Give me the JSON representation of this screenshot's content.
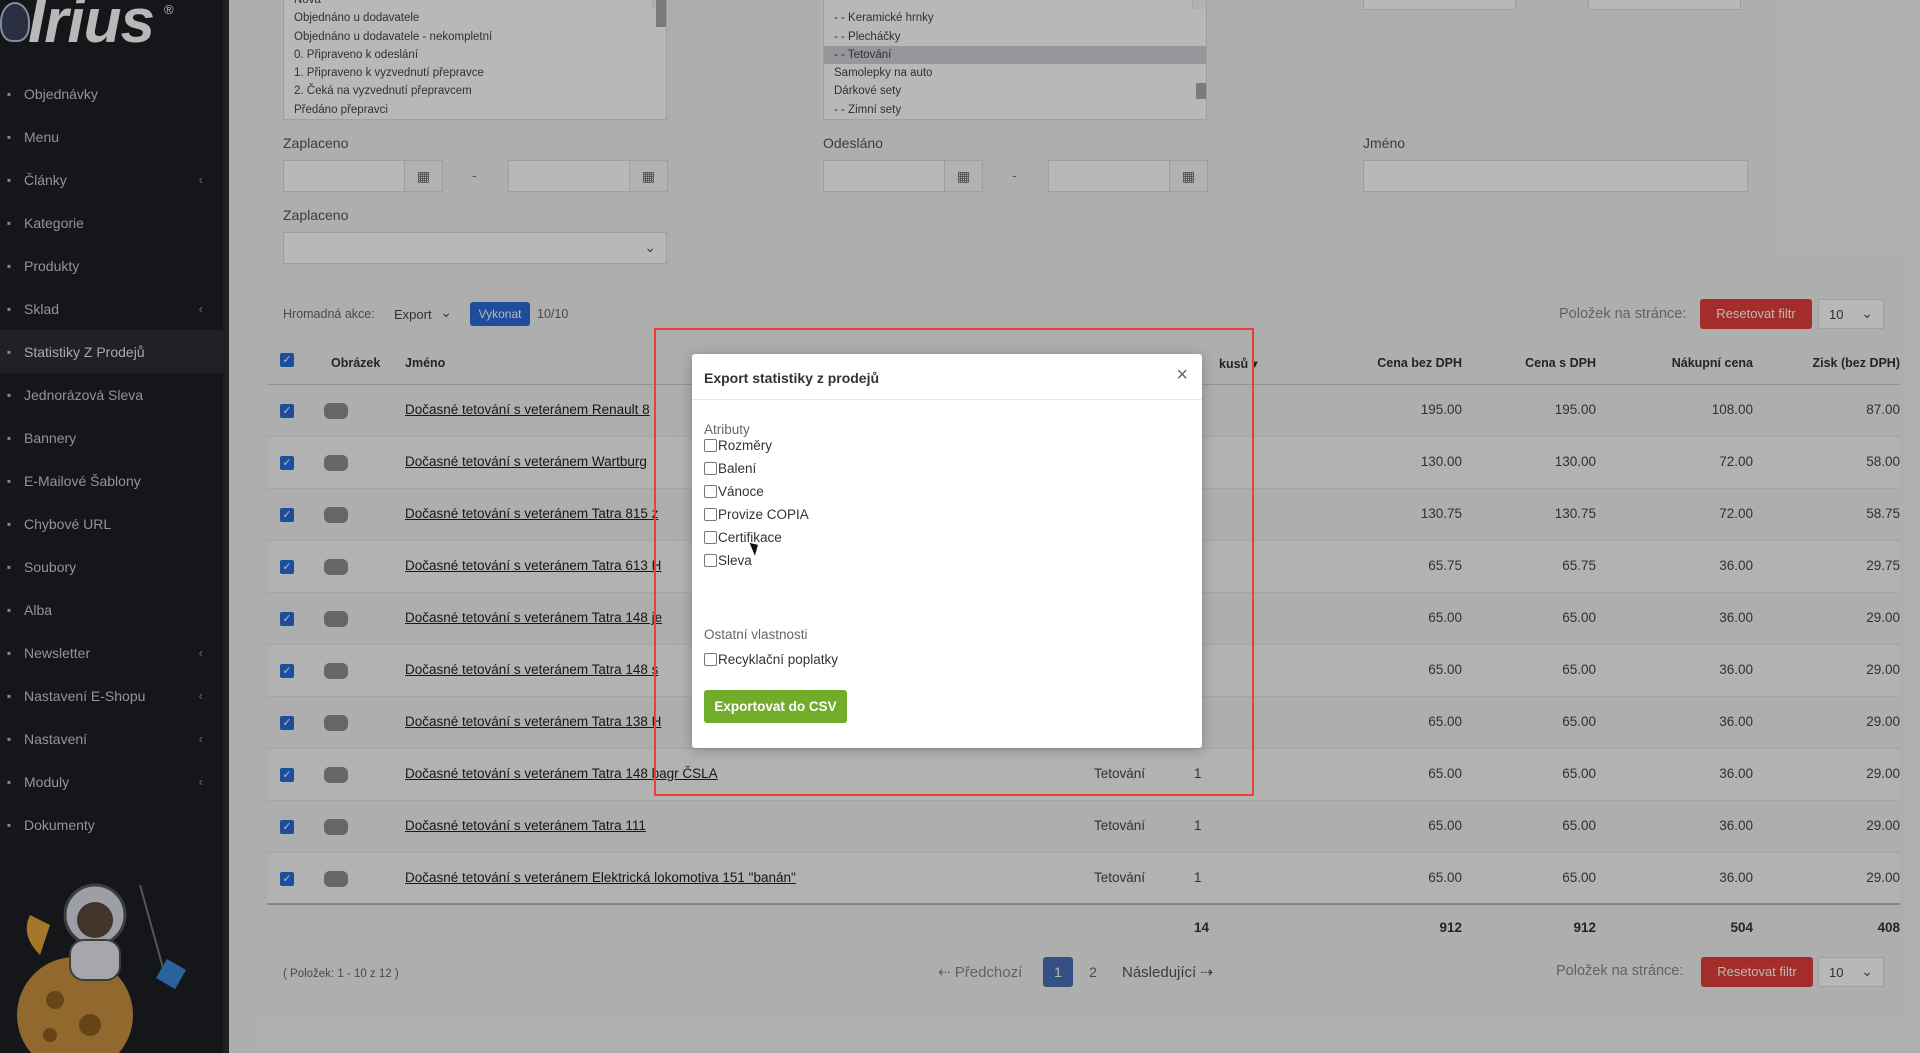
{
  "brand": {
    "logo_text": "Irius",
    "reg": "®"
  },
  "sidebar": {
    "items": [
      {
        "label": "Objednávky",
        "icon": "cart-icon",
        "chevron": false,
        "active": false
      },
      {
        "label": "Menu",
        "icon": "menu-icon",
        "chevron": false,
        "active": false
      },
      {
        "label": "Články",
        "icon": "pencil-icon",
        "chevron": true,
        "active": false
      },
      {
        "label": "Kategorie",
        "icon": "list-icon",
        "chevron": false,
        "active": false
      },
      {
        "label": "Produkty",
        "icon": "ball-icon",
        "chevron": false,
        "active": false
      },
      {
        "label": "Sklad",
        "icon": "warehouse-icon",
        "chevron": true,
        "active": false
      },
      {
        "label": "Statistiky Z Prodejů",
        "icon": "chart-icon",
        "chevron": false,
        "active": true
      },
      {
        "label": "Jednorázová Sleva",
        "icon": "tag-icon",
        "chevron": false,
        "active": false
      },
      {
        "label": "Bannery",
        "icon": "image-icon",
        "chevron": false,
        "active": false
      },
      {
        "label": "E-Mailové Šablony",
        "icon": "mail-icon",
        "chevron": false,
        "active": false
      },
      {
        "label": "Chybové URL",
        "icon": "link-icon",
        "chevron": false,
        "active": false
      },
      {
        "label": "Soubory",
        "icon": "file-icon",
        "chevron": false,
        "active": false
      },
      {
        "label": "Alba",
        "icon": "camera-icon",
        "chevron": false,
        "active": false
      },
      {
        "label": "Newsletter",
        "icon": "newsletter-icon",
        "chevron": true,
        "active": false
      },
      {
        "label": "Nastavení E-Shopu",
        "icon": "gear-icon",
        "chevron": true,
        "active": false
      },
      {
        "label": "Nastavení",
        "icon": "cog-icon",
        "chevron": true,
        "active": false
      },
      {
        "label": "Moduly",
        "icon": "puzzle-icon",
        "chevron": true,
        "active": false
      },
      {
        "label": "Dokumenty",
        "icon": "docs-icon",
        "chevron": false,
        "active": false
      }
    ]
  },
  "filters": {
    "status_list": [
      "Nová",
      "Objednáno u dodavatele",
      "Objednáno u dodavatele - nekompletní",
      "0. Připraveno k odeslání",
      "1. Připraveno k vyzvednutí přepravce",
      "2. Čeká na vyzvednutí přepravcem",
      "Předáno přepravci"
    ],
    "category_list": [
      "- - Keramické hrnky",
      "- - Plecháčky",
      "- - Tetování",
      "Samolepky na auto",
      "Dárkové sety",
      "- - Zimní sety"
    ],
    "category_selected_index": 2,
    "paid_label": "Zaplaceno",
    "sent_label": "Odesláno",
    "name_label": "Jméno",
    "paid_select_label": "Zaplaceno",
    "range_dash": "-"
  },
  "toolbar": {
    "bulk_label": "Hromadná akce:",
    "bulk_value": "Export",
    "execute": "Vykonat",
    "count": "10/10",
    "per_page_label": "Položek na stránce:",
    "reset": "Resetovat filtr",
    "per_page_value": "10"
  },
  "table": {
    "headers": {
      "image": "Obrázek",
      "name": "Jméno",
      "pieces": "kusů",
      "price_ex": "Cena bez DPH",
      "price_inc": "Cena s DPH",
      "purchase": "Nákupní cena",
      "profit": "Zisk (bez DPH)"
    },
    "rows": [
      {
        "name": "Dočasné tetování s veteránem Renault 8",
        "category": "",
        "qty": "",
        "price_ex": "195.00",
        "price_inc": "195.00",
        "purchase": "108.00",
        "profit": "87.00"
      },
      {
        "name": "Dočasné tetování s veteránem Wartburg",
        "category": "",
        "qty": "",
        "price_ex": "130.00",
        "price_inc": "130.00",
        "purchase": "72.00",
        "profit": "58.00"
      },
      {
        "name": "Dočasné tetování s veteránem Tatra 815 z",
        "category": "",
        "qty": "",
        "price_ex": "130.75",
        "price_inc": "130.75",
        "purchase": "72.00",
        "profit": "58.75"
      },
      {
        "name": "Dočasné tetování s veteránem Tatra 613 H",
        "category": "",
        "qty": "",
        "price_ex": "65.75",
        "price_inc": "65.75",
        "purchase": "36.00",
        "profit": "29.75"
      },
      {
        "name": "Dočasné tetování s veteránem Tatra 148 je",
        "category": "",
        "qty": "",
        "price_ex": "65.00",
        "price_inc": "65.00",
        "purchase": "36.00",
        "profit": "29.00"
      },
      {
        "name": "Dočasné tetování s veteránem Tatra 148 s",
        "category": "",
        "qty": "",
        "price_ex": "65.00",
        "price_inc": "65.00",
        "purchase": "36.00",
        "profit": "29.00"
      },
      {
        "name": "Dočasné tetování s veteránem Tatra 138 H",
        "category": "",
        "qty": "",
        "price_ex": "65.00",
        "price_inc": "65.00",
        "purchase": "36.00",
        "profit": "29.00"
      },
      {
        "name": "Dočasné tetování s veteránem Tatra 148 bagr ČSLA",
        "category": "Tetování",
        "qty": "1",
        "price_ex": "65.00",
        "price_inc": "65.00",
        "purchase": "36.00",
        "profit": "29.00"
      },
      {
        "name": "Dočasné tetování s veteránem Tatra 111",
        "category": "Tetování",
        "qty": "1",
        "price_ex": "65.00",
        "price_inc": "65.00",
        "purchase": "36.00",
        "profit": "29.00"
      },
      {
        "name": "Dočasné tetování s veteránem Elektrická lokomotiva 151 \"banán\"",
        "category": "Tetování",
        "qty": "1",
        "price_ex": "65.00",
        "price_inc": "65.00",
        "purchase": "36.00",
        "profit": "29.00"
      }
    ],
    "totals": {
      "qty": "14",
      "price_ex": "912",
      "price_inc": "912",
      "purchase": "504",
      "profit": "408"
    }
  },
  "pagination": {
    "info": "( Položek: 1 - 10 z 12 )",
    "prev": "Předchozí",
    "pages": [
      "1",
      "2"
    ],
    "next": "Následující",
    "per_page_label": "Položek na stránce:",
    "reset": "Resetovat filtr",
    "per_page_value": "10"
  },
  "modal": {
    "title": "Export statistiky z prodejů",
    "close": "×",
    "section_attributes": "Atributy",
    "attributes": [
      "Rozměry",
      "Balení",
      "Vánoce",
      "Provize COPIA",
      "Certifikace",
      "Sleva"
    ],
    "section_other": "Ostatní vlastnosti",
    "other": [
      "Recyklační poplatky"
    ],
    "export_button": "Exportovat do CSV"
  }
}
